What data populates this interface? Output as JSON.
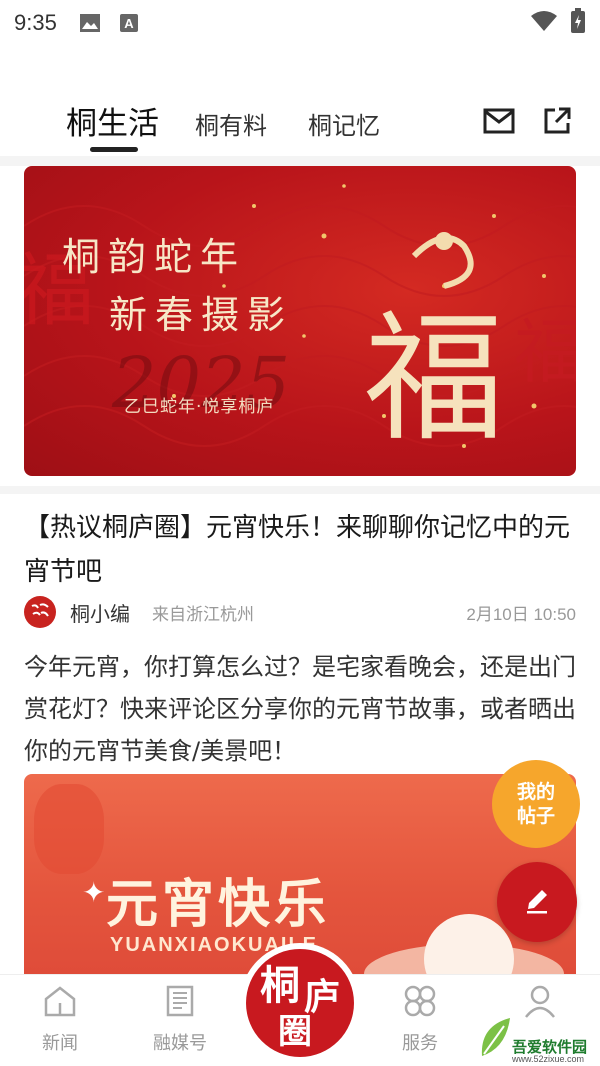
{
  "status_bar": {
    "time": "9:35"
  },
  "top_tabs": [
    {
      "label": "桐生活",
      "active": true
    },
    {
      "label": "桐有料",
      "active": false
    },
    {
      "label": "桐记忆",
      "active": false
    }
  ],
  "banner": {
    "line1": "桐韵蛇年",
    "line2": "新春摄影",
    "big_char": "福",
    "year": "2025",
    "subtitle": "乙巳蛇年·悦享桐庐"
  },
  "post": {
    "title": "【热议桐庐圈】元宵快乐！来聊聊你记忆中的元宵节吧",
    "author": "桐小编",
    "location": "来自浙江杭州",
    "time": "2月10日 10:50",
    "body": "今年元宵，你打算怎么过？是宅家看晚会，还是出门赏花灯？快来评论区分享你的元宵节故事，或者晒出你的元宵节美食/美景吧！"
  },
  "banner2": {
    "title": "元宵快乐",
    "subtitle": "YUANXIAOKUAILE"
  },
  "fab": {
    "my_posts_line1": "我的",
    "my_posts_line2": "帖子"
  },
  "bottom_nav": [
    {
      "label": "新闻"
    },
    {
      "label": "融媒号"
    },
    {
      "label": "服务"
    }
  ],
  "center_logo": {
    "text": "桐庐圈"
  },
  "watermark": {
    "text": "吾爱软件园",
    "url": "www.52zixue.com"
  },
  "colors": {
    "brand_red": "#c8191f",
    "fab_orange": "#f6a62c"
  }
}
